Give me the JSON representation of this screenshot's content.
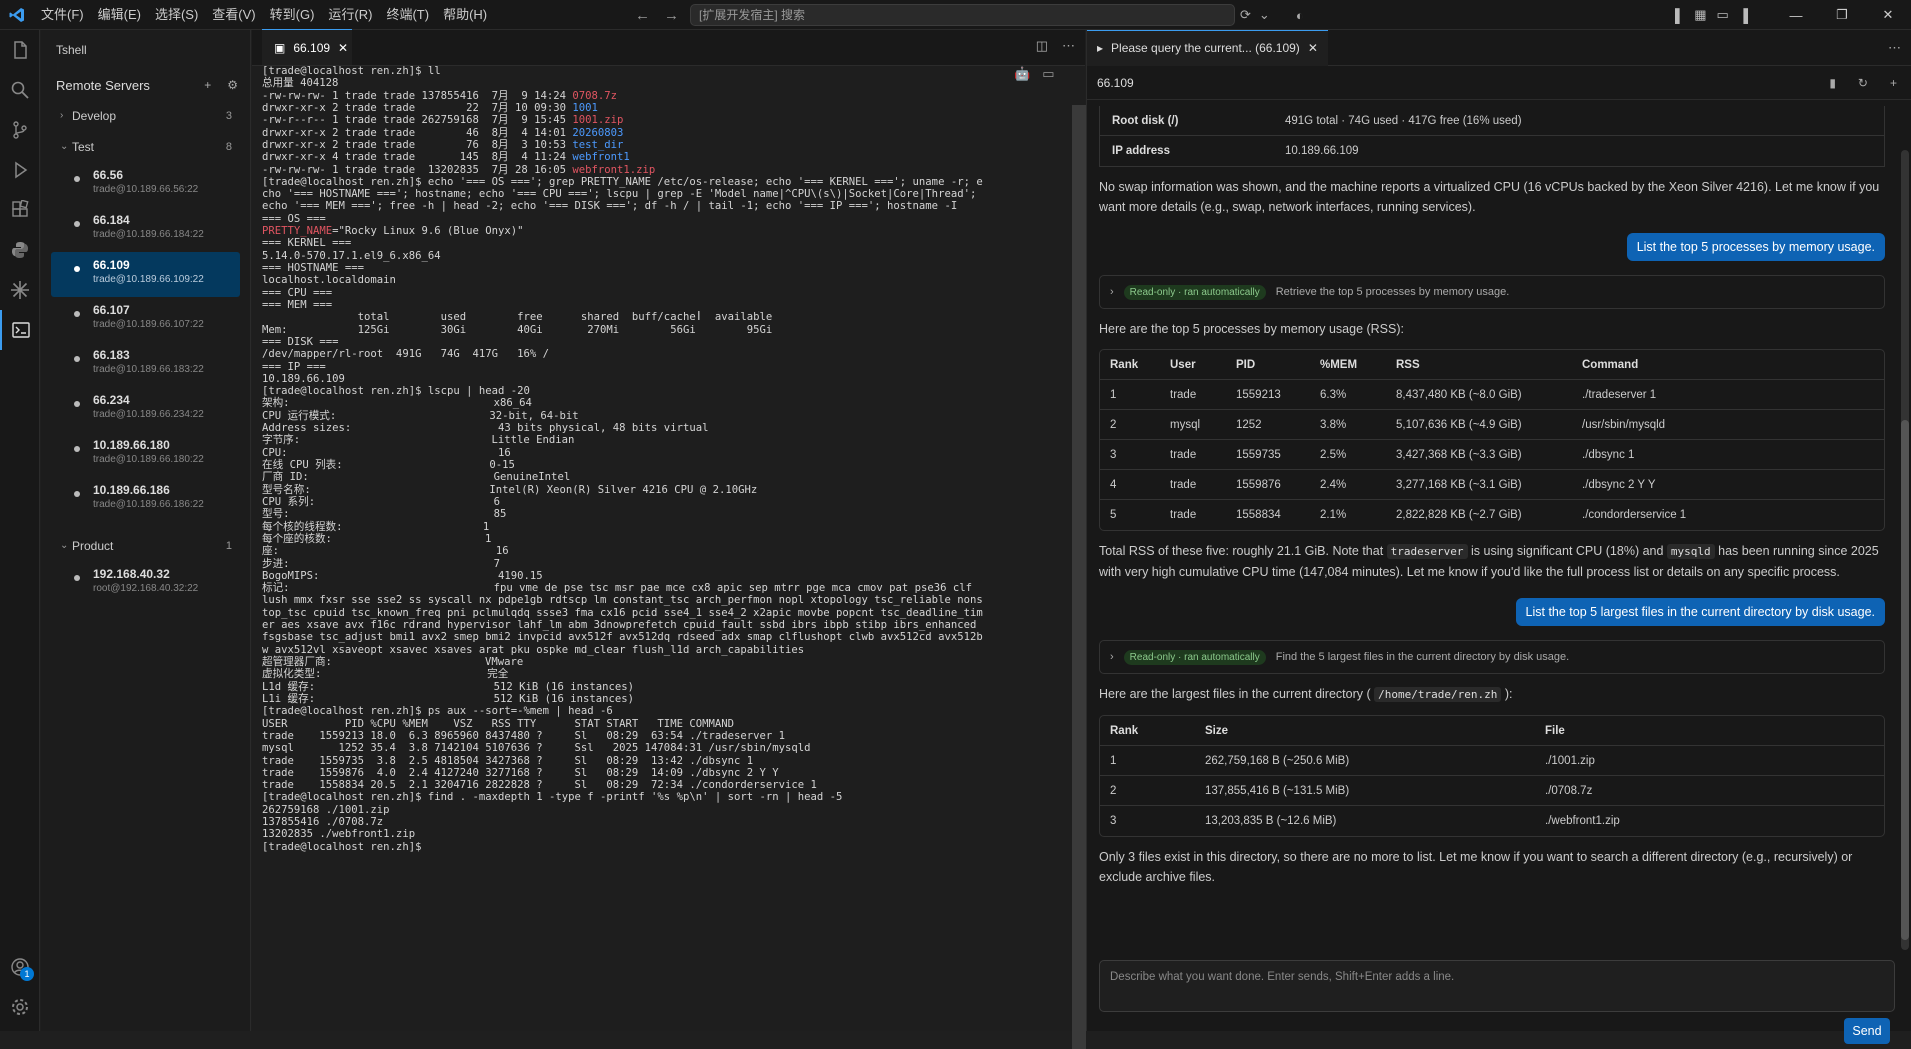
{
  "menu": [
    "文件(F)",
    "编辑(E)",
    "选择(S)",
    "查看(V)",
    "转到(G)",
    "运行(R)",
    "终端(T)",
    "帮助(H)"
  ],
  "search_placeholder": "[扩展开发宿主] 搜索",
  "sidebar": {
    "title": "Tshell",
    "remote_servers": "Remote Servers",
    "groups": [
      {
        "name": "Develop",
        "count": "3",
        "expanded": false,
        "hosts": []
      },
      {
        "name": "Test",
        "count": "8",
        "expanded": true,
        "hosts": [
          {
            "name": "66.56",
            "addr": "trade@10.189.66.56:22"
          },
          {
            "name": "66.184",
            "addr": "trade@10.189.66.184:22"
          },
          {
            "name": "66.109",
            "addr": "trade@10.189.66.109:22",
            "active": true
          },
          {
            "name": "66.107",
            "addr": "trade@10.189.66.107:22"
          },
          {
            "name": "66.183",
            "addr": "trade@10.189.66.183:22"
          },
          {
            "name": "66.234",
            "addr": "trade@10.189.66.234:22"
          },
          {
            "name": "10.189.66.180",
            "addr": "trade@10.189.66.180:22"
          },
          {
            "name": "10.189.66.186",
            "addr": "trade@10.189.66.186:22"
          }
        ]
      },
      {
        "name": "Product",
        "count": "1",
        "expanded": true,
        "hosts": [
          {
            "name": "192.168.40.32",
            "addr": "root@192.168.40.32:22"
          }
        ]
      }
    ]
  },
  "editor": {
    "tab_label": "66.109",
    "terminal_lines": [
      [
        [
          "[trade@localhost ren.zh]$ ll",
          ""
        ]
      ],
      [
        [
          "总用量 404128",
          ""
        ]
      ],
      [
        [
          "-rw-rw-rw- 1 trade trade 137855416  7月  9 14:24 ",
          ""
        ],
        [
          "0708.7z",
          "red"
        ]
      ],
      [
        [
          "drwxr-xr-x 2 trade trade        22  7月 10 09:30 ",
          ""
        ],
        [
          "1001",
          "blue"
        ]
      ],
      [
        [
          "-rw-r--r-- 1 trade trade 262759168  7月  9 15:45 ",
          ""
        ],
        [
          "1001.zip",
          "red"
        ]
      ],
      [
        [
          "drwxr-xr-x 2 trade trade        46  8月  4 14:01 ",
          ""
        ],
        [
          "20260803",
          "blue"
        ]
      ],
      [
        [
          "drwxr-xr-x 2 trade trade        76  8月  3 10:53 ",
          ""
        ],
        [
          "test_dir",
          "blue"
        ]
      ],
      [
        [
          "drwxr-xr-x 4 trade trade       145  8月  4 11:24 ",
          ""
        ],
        [
          "webfront1",
          "blue"
        ]
      ],
      [
        [
          "-rw-rw-rw- 1 trade trade  13202835  7月 28 16:05 ",
          ""
        ],
        [
          "webfront1.zip",
          "red"
        ]
      ],
      [
        [
          "[trade@localhost ren.zh]$ echo '=== OS ==='; grep PRETTY_NAME /etc/os-release; echo '=== KERNEL ==='; uname -r; e",
          ""
        ]
      ],
      [
        [
          "cho '=== HOSTNAME ==='; hostname; echo '=== CPU ==='; lscpu | grep -E 'Model name|^CPU\\(s\\)|Socket|Core|Thread';",
          ""
        ]
      ],
      [
        [
          "echo '=== MEM ==='; free -h | head -2; echo '=== DISK ==='; df -h / | tail -1; echo '=== IP ==='; hostname -I",
          ""
        ]
      ],
      [
        [
          "=== OS ===",
          ""
        ]
      ],
      [
        [
          "PRETTY_NAME",
          "red"
        ],
        [
          "=\"Rocky Linux 9.6 (Blue Onyx)\"",
          ""
        ]
      ],
      [
        [
          "=== KERNEL ===",
          ""
        ]
      ],
      [
        [
          "5.14.0-570.17.1.el9_6.x86_64",
          ""
        ]
      ],
      [
        [
          "=== HOSTNAME ===",
          ""
        ]
      ],
      [
        [
          "localhost.localdomain",
          ""
        ]
      ],
      [
        [
          "=== CPU ===",
          ""
        ]
      ],
      [
        [
          "=== MEM ===",
          ""
        ]
      ],
      [
        [
          "               total        used        free      shared  buff/cache   available",
          ""
        ]
      ],
      [
        [
          "Mem:           125Gi        30Gi        40Gi       270Mi        56Gi        95Gi",
          ""
        ]
      ],
      [
        [
          "=== DISK ===",
          ""
        ]
      ],
      [
        [
          "/dev/mapper/rl-root  491G   74G  417G   16% /",
          ""
        ]
      ],
      [
        [
          "=== IP ===",
          ""
        ]
      ],
      [
        [
          "10.189.66.109",
          ""
        ]
      ],
      [
        [
          "[trade@localhost ren.zh]$ lscpu | head -20",
          ""
        ]
      ],
      [
        [
          "架构:                                x86_64",
          ""
        ]
      ],
      [
        [
          "CPU 运行模式:                        32-bit, 64-bit",
          ""
        ]
      ],
      [
        [
          "Address sizes:                       43 bits physical, 48 bits virtual",
          ""
        ]
      ],
      [
        [
          "字节序:                              Little Endian",
          ""
        ]
      ],
      [
        [
          "CPU:                                 16",
          ""
        ]
      ],
      [
        [
          "在线 CPU 列表:                       0-15",
          ""
        ]
      ],
      [
        [
          "厂商 ID:                             GenuineIntel",
          ""
        ]
      ],
      [
        [
          "型号名称:                            Intel(R) Xeon(R) Silver 4216 CPU @ 2.10GHz",
          ""
        ]
      ],
      [
        [
          "CPU 系列:                            6",
          ""
        ]
      ],
      [
        [
          "型号:                                85",
          ""
        ]
      ],
      [
        [
          "每个核的线程数:                      1",
          ""
        ]
      ],
      [
        [
          "每个座的核数:                        1",
          ""
        ]
      ],
      [
        [
          "座:                                  16",
          ""
        ]
      ],
      [
        [
          "步进:                                7",
          ""
        ]
      ],
      [
        [
          "BogoMIPS:                            4190.15",
          ""
        ]
      ],
      [
        [
          "标记:                                fpu vme de pse tsc msr pae mce cx8 apic sep mtrr pge mca cmov pat pse36 clf",
          ""
        ]
      ],
      [
        [
          "lush mmx fxsr sse sse2 ss syscall nx pdpe1gb rdtscp lm constant_tsc arch_perfmon nopl xtopology tsc_reliable nons",
          ""
        ]
      ],
      [
        [
          "top_tsc cpuid tsc_known_freq pni pclmulqdq ssse3 fma cx16 pcid sse4_1 sse4_2 x2apic movbe popcnt tsc_deadline_tim",
          ""
        ]
      ],
      [
        [
          "er aes xsave avx f16c rdrand hypervisor lahf_lm abm 3dnowprefetch cpuid_fault ssbd ibrs ibpb stibp ibrs_enhanced",
          ""
        ]
      ],
      [
        [
          "fsgsbase tsc_adjust bmi1 avx2 smep bmi2 invpcid avx512f avx512dq rdseed adx smap clflushopt clwb avx512cd avx512b",
          ""
        ]
      ],
      [
        [
          "w avx512vl xsaveopt xsavec xsaves arat pku ospke md_clear flush_l1d arch_capabilities",
          ""
        ]
      ],
      [
        [
          "超管理器厂商:                        VMware",
          ""
        ]
      ],
      [
        [
          "虚拟化类型:                          完全",
          ""
        ]
      ],
      [
        [
          "L1d 缓存:                            512 KiB (16 instances)",
          ""
        ]
      ],
      [
        [
          "L1i 缓存:                            512 KiB (16 instances)",
          ""
        ]
      ],
      [
        [
          "[trade@localhost ren.zh]$ ps aux --sort=-%mem | head -6",
          ""
        ]
      ],
      [
        [
          "USER         PID %CPU %MEM    VSZ   RSS TTY      STAT START   TIME COMMAND",
          ""
        ]
      ],
      [
        [
          "trade    1559213 18.0  6.3 8965960 8437480 ?     Sl   08:29  63:54 ./tradeserver 1",
          ""
        ]
      ],
      [
        [
          "mysql       1252 35.4  3.8 7142104 5107636 ?     Ssl   2025 147084:31 /usr/sbin/mysqld",
          ""
        ]
      ],
      [
        [
          "trade    1559735  3.8  2.5 4818504 3427368 ?     Sl   08:29  13:42 ./dbsync 1",
          ""
        ]
      ],
      [
        [
          "trade    1559876  4.0  2.4 4127240 3277168 ?     Sl   08:29  14:09 ./dbsync 2 Y Y",
          ""
        ]
      ],
      [
        [
          "trade    1558834 20.5  2.1 3204716 2822828 ?     Sl   08:29  72:34 ./condorderservice 1",
          ""
        ]
      ],
      [
        [
          "[trade@localhost ren.zh]$ find . -maxdepth 1 -type f -printf '%s %p\\n' | sort -rn | head -5",
          ""
        ]
      ],
      [
        [
          "262759168 ./1001.zip",
          ""
        ]
      ],
      [
        [
          "137855416 ./0708.7z",
          ""
        ]
      ],
      [
        [
          "13202835 ./webfront1.zip",
          ""
        ]
      ],
      [
        [
          "[trade@localhost ren.zh]$ ",
          ""
        ]
      ]
    ]
  },
  "chat": {
    "tab_label": "Please query the current... (66.109)",
    "header": "66.109",
    "sysinfo": [
      {
        "k": "Root disk (/)",
        "v": "491G total · 74G used · 417G free (16% used)"
      },
      {
        "k": "IP address",
        "v": "10.189.66.109"
      }
    ],
    "para1": "No swap information was shown, and the machine reports a virtualized CPU (16 vCPUs backed by the Xeon Silver 4216). Let me know if you want more details (e.g., swap, network interfaces, running services).",
    "user1": "List the top 5 processes by memory usage.",
    "tool_pill": "Read-only · ran automatically",
    "tool1": "Retrieve the top 5 processes by memory usage.",
    "para2": "Here are the top 5 processes by memory usage (RSS):",
    "proc_headers": [
      "Rank",
      "User",
      "PID",
      "%MEM",
      "RSS",
      "Command"
    ],
    "proc_rows": [
      [
        "1",
        "trade",
        "1559213",
        "6.3%",
        "8,437,480 KB (~8.0 GiB)",
        "./tradeserver 1"
      ],
      [
        "2",
        "mysql",
        "1252",
        "3.8%",
        "5,107,636 KB (~4.9 GiB)",
        "/usr/sbin/mysqld"
      ],
      [
        "3",
        "trade",
        "1559735",
        "2.5%",
        "3,427,368 KB (~3.3 GiB)",
        "./dbsync 1"
      ],
      [
        "4",
        "trade",
        "1559876",
        "2.4%",
        "3,277,168 KB (~3.1 GiB)",
        "./dbsync 2 Y Y"
      ],
      [
        "5",
        "trade",
        "1558834",
        "2.1%",
        "2,822,828 KB (~2.7 GiB)",
        "./condorderservice 1"
      ]
    ],
    "para3_a": "Total RSS of these five: roughly 21.1 GiB. Note that ",
    "para3_code1": "tradeserver",
    "para3_b": " is using significant CPU (18%) and ",
    "para3_code2": "mysqld",
    "para3_c": " has been running since 2025 with very high cumulative CPU time (147,084 minutes). Let me know if you'd like the full process list or details on any specific process.",
    "user2": "List the top 5 largest files in the current directory by disk usage.",
    "tool2": "Find the 5 largest files in the current directory by disk usage.",
    "para4_a": "Here are the largest files in the current directory ( ",
    "para4_code": "/home/trade/ren.zh",
    "para4_b": " ):",
    "file_headers": [
      "Rank",
      "Size",
      "File"
    ],
    "file_rows": [
      [
        "1",
        "262,759,168 B (~250.6 MiB)",
        "./1001.zip"
      ],
      [
        "2",
        "137,855,416 B (~131.5 MiB)",
        "./0708.7z"
      ],
      [
        "3",
        "13,203,835 B (~12.6 MiB)",
        "./webfront1.zip"
      ]
    ],
    "para5": "Only 3 files exist in this directory, so there are no more to list. Let me know if you want to search a different directory (e.g., recursively) or exclude archive files.",
    "composer_placeholder": "Describe what you want done. Enter sends, Shift+Enter adds a line.",
    "send_label": "Send"
  },
  "accounts_badge": "1"
}
